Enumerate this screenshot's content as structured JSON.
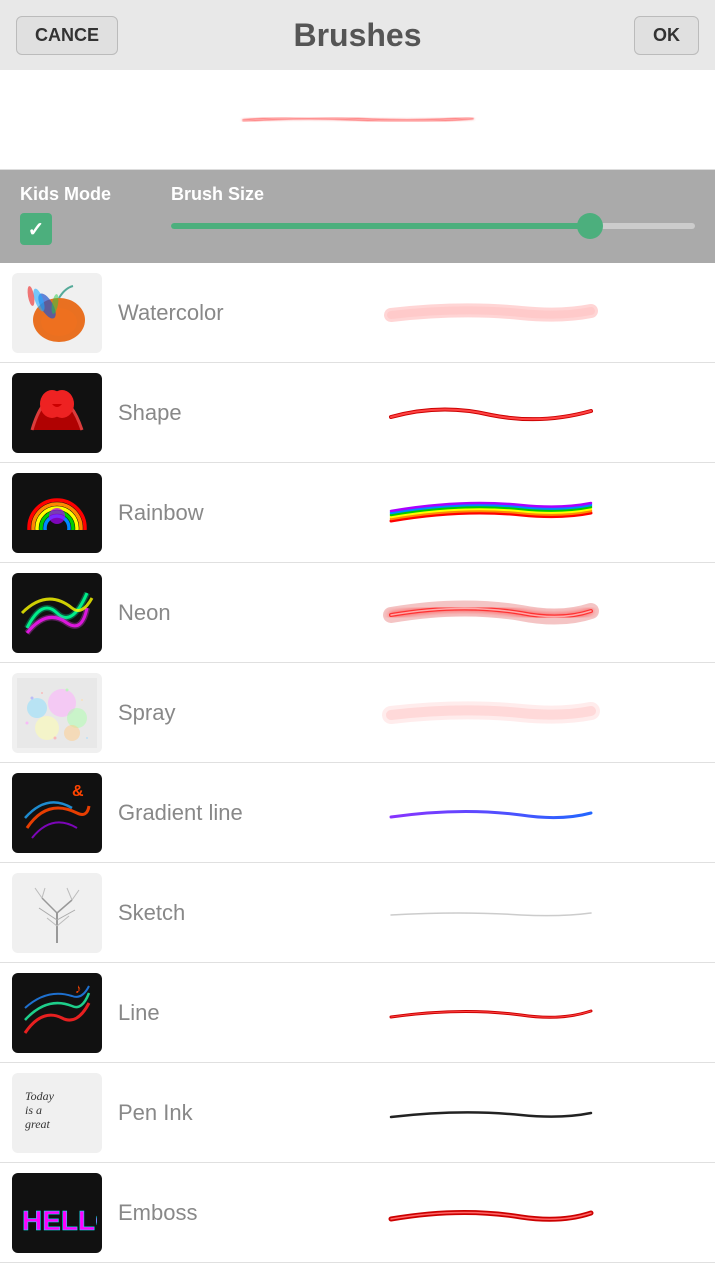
{
  "header": {
    "title": "Brushes",
    "cancel_label": "CANCE",
    "ok_label": "OK"
  },
  "controls": {
    "kids_mode_label": "Kids Mode",
    "brush_size_label": "Brush Size",
    "kids_mode_checked": true,
    "slider_percent": 80
  },
  "brushes": [
    {
      "id": "watercolor",
      "name": "Watercolor",
      "thumb_type": "watercolor"
    },
    {
      "id": "shape",
      "name": "Shape",
      "thumb_type": "shape"
    },
    {
      "id": "rainbow",
      "name": "Rainbow",
      "thumb_type": "rainbow"
    },
    {
      "id": "neon",
      "name": "Neon",
      "thumb_type": "neon"
    },
    {
      "id": "spray",
      "name": "Spray",
      "thumb_type": "spray"
    },
    {
      "id": "gradient",
      "name": "Gradient line",
      "thumb_type": "gradient"
    },
    {
      "id": "sketch",
      "name": "Sketch",
      "thumb_type": "sketch"
    },
    {
      "id": "line",
      "name": "Line",
      "thumb_type": "line"
    },
    {
      "id": "penink",
      "name": "Pen Ink",
      "thumb_type": "penink"
    },
    {
      "id": "emboss",
      "name": "Emboss",
      "thumb_type": "emboss"
    }
  ]
}
